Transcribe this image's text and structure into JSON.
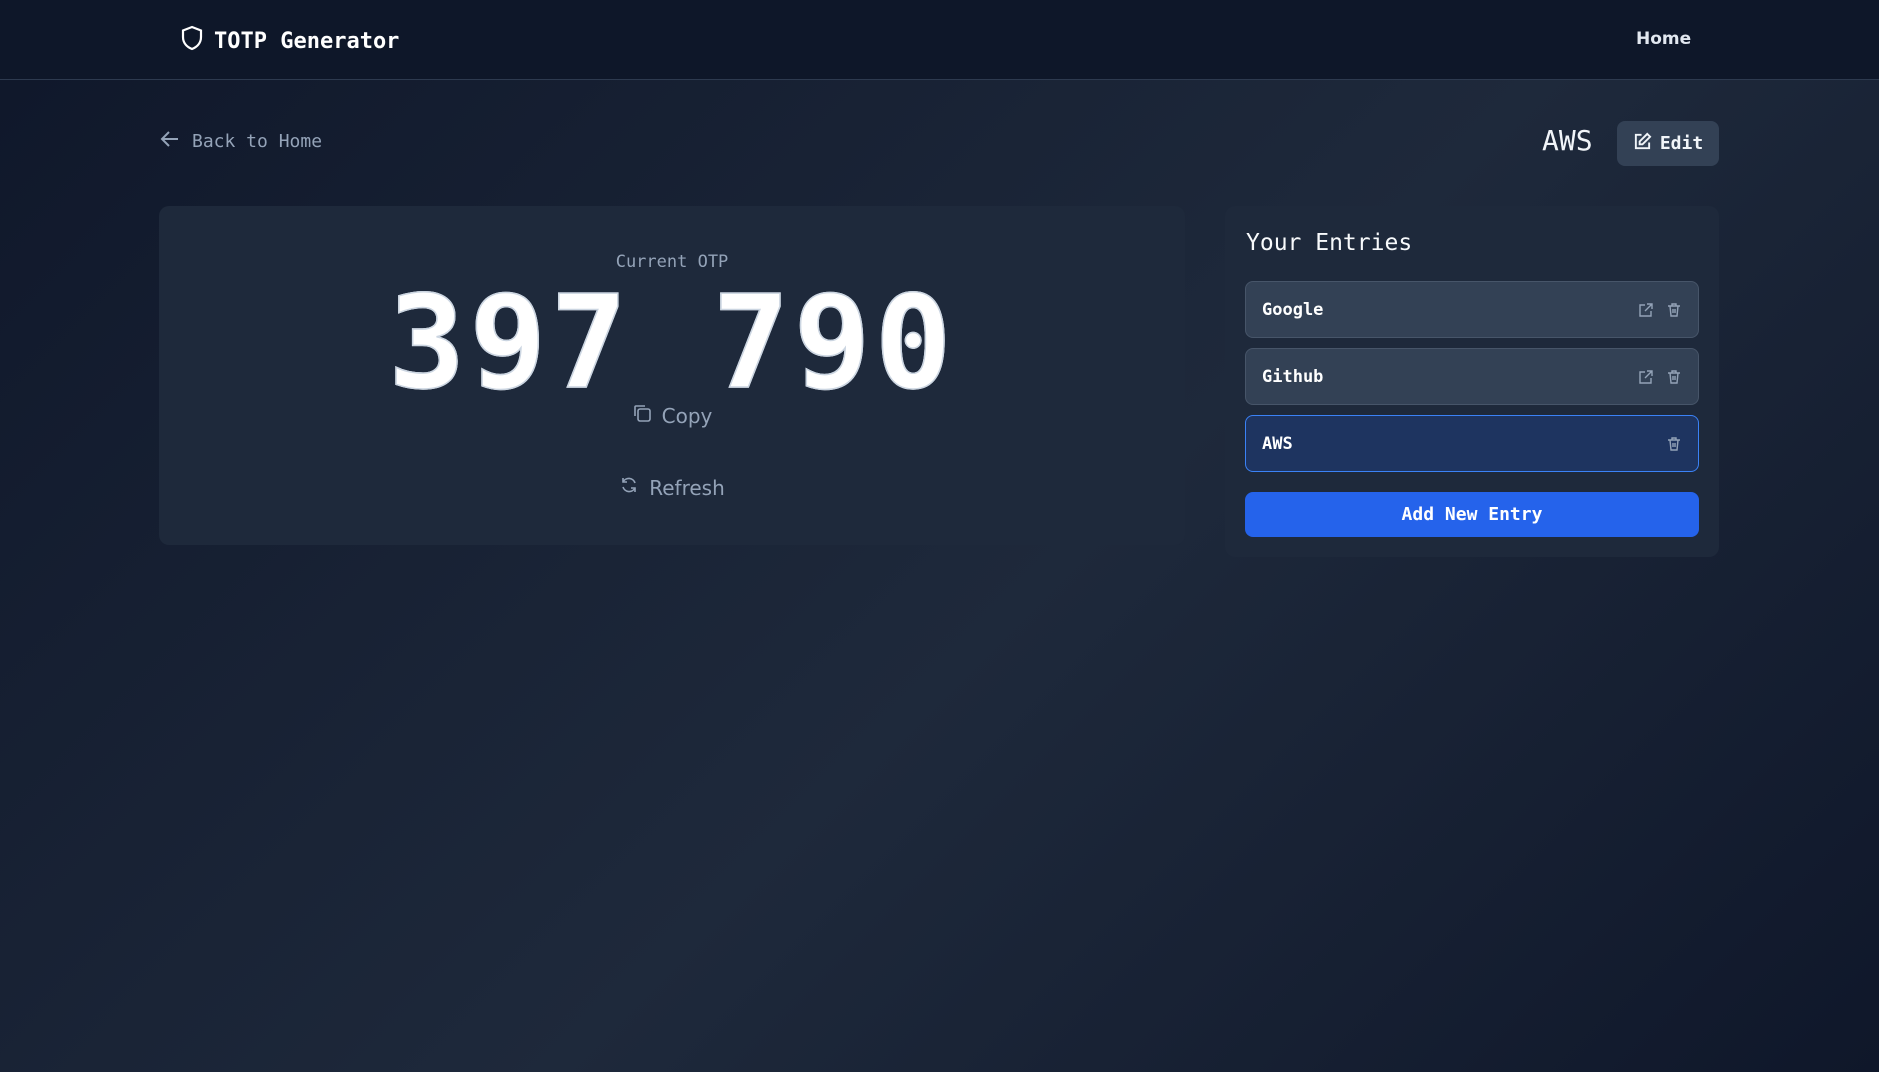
{
  "header": {
    "title": "TOTP Generator",
    "nav_home": "Home"
  },
  "nav": {
    "back": "Back to Home"
  },
  "entry_title": "AWS",
  "edit_label": "Edit",
  "otp": {
    "label": "Current OTP",
    "code": "397 790",
    "copy": "Copy",
    "refresh": "Refresh"
  },
  "entries": {
    "title": "Your Entries",
    "items": [
      {
        "name": "Google",
        "active": false
      },
      {
        "name": "Github",
        "active": false
      },
      {
        "name": "AWS",
        "active": true
      }
    ],
    "add_label": "Add New Entry"
  },
  "colors": {
    "accent": "#2563eb",
    "active_border": "#3b82f6"
  }
}
